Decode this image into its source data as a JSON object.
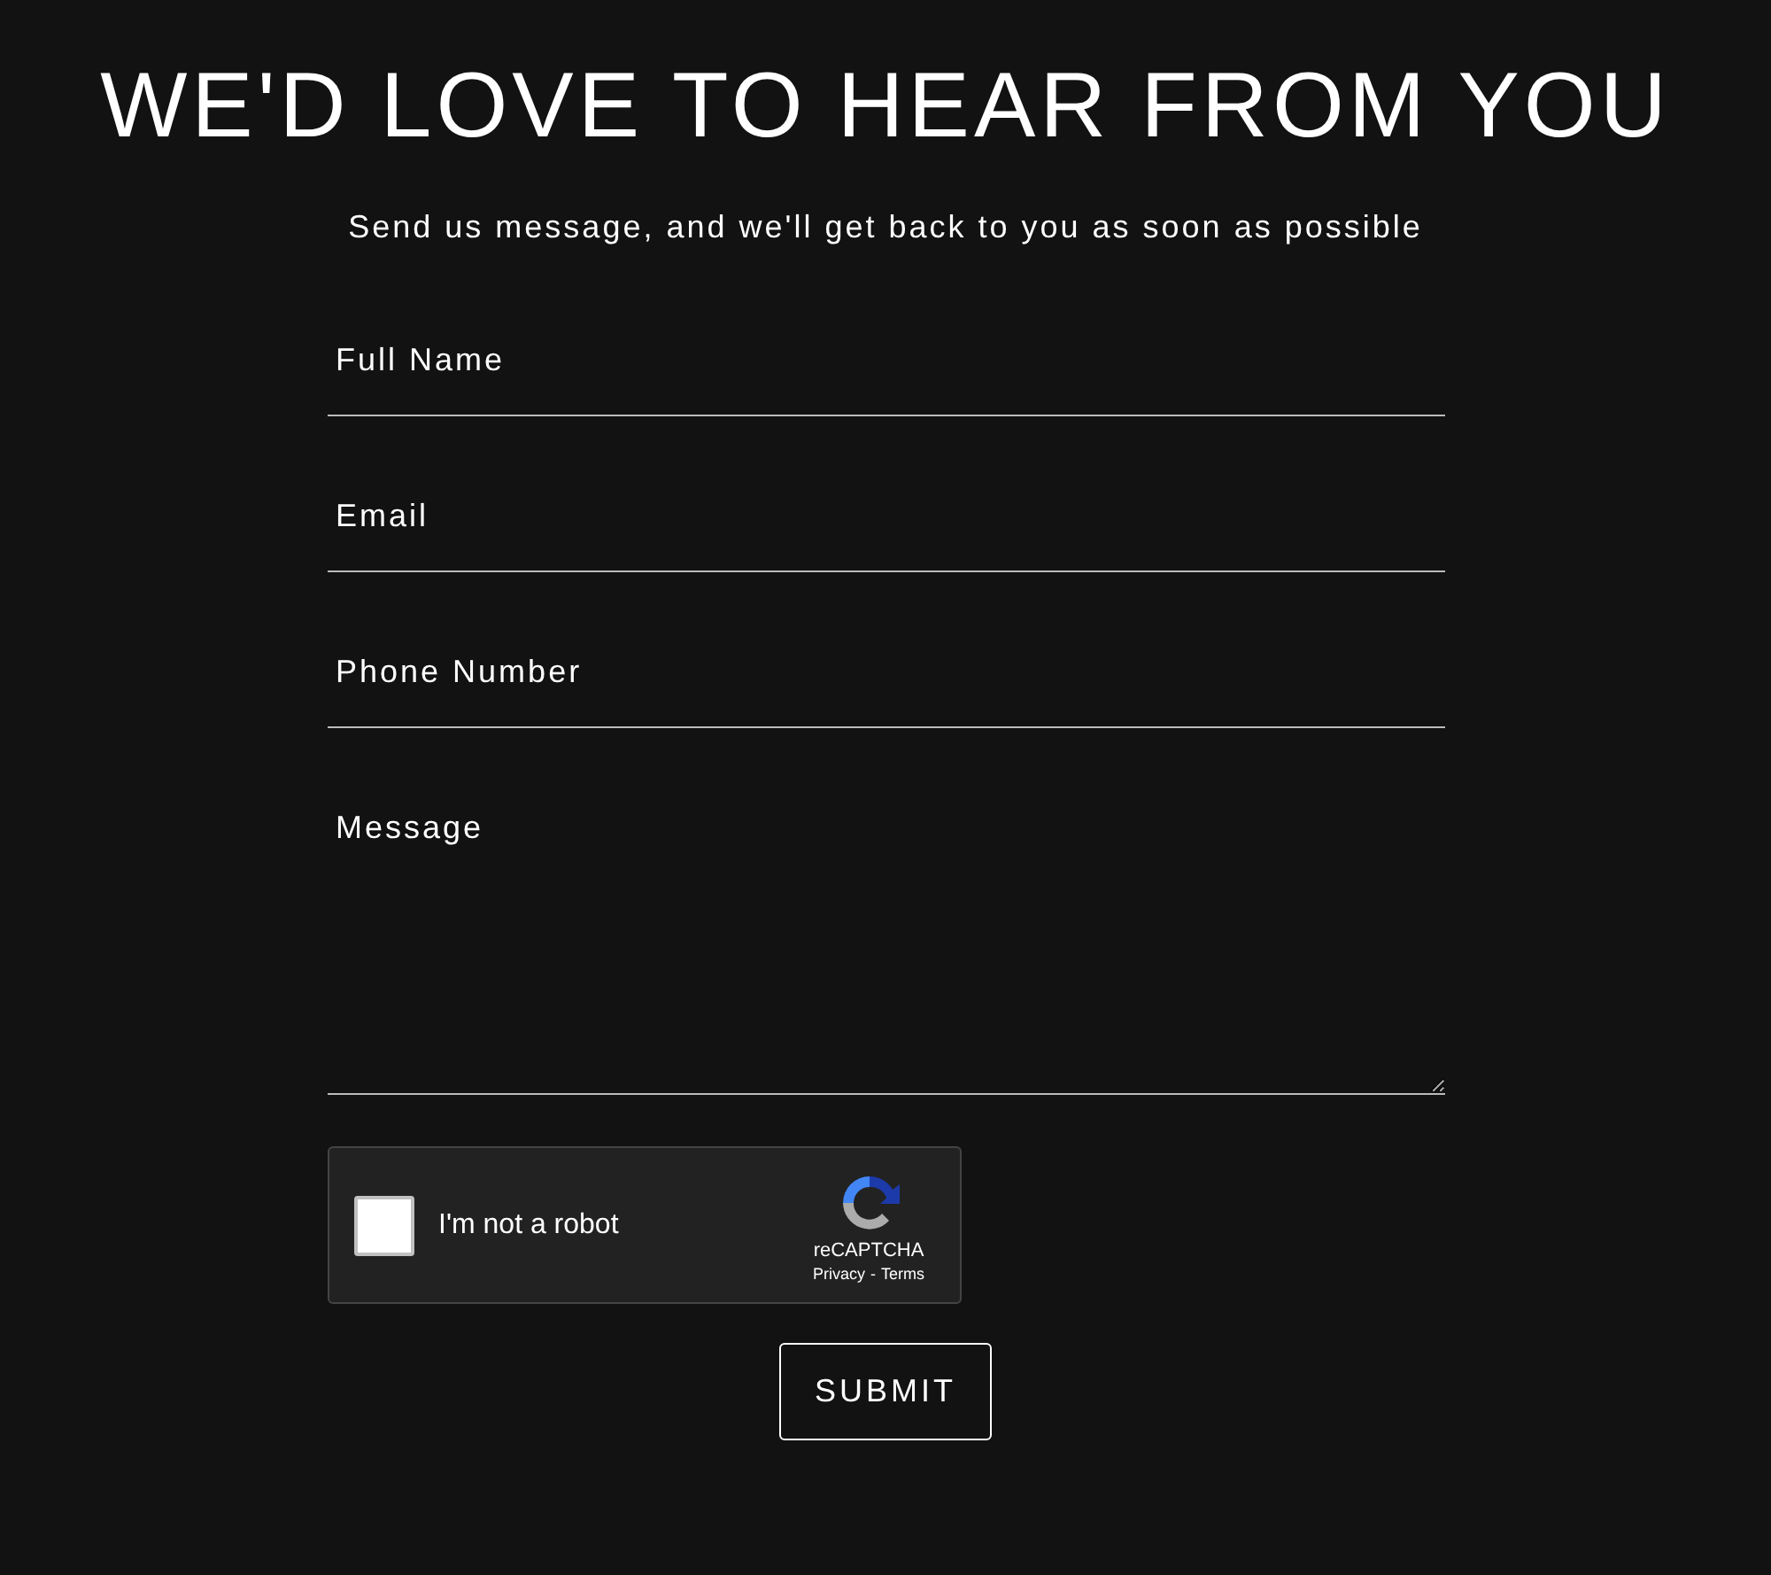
{
  "heading": "WE'D LOVE TO HEAR FROM YOU",
  "subheading": "Send us message, and we'll get back to you as soon as possible",
  "fields": [
    {
      "kind": "input",
      "placeholder": "Full Name"
    },
    {
      "kind": "input",
      "placeholder": "Email"
    },
    {
      "kind": "input",
      "placeholder": "Phone Number"
    },
    {
      "kind": "textarea",
      "placeholder": "Message"
    }
  ],
  "captcha": {
    "label": "I'm not a robot",
    "checked": false,
    "brand": "reCAPTCHA",
    "links": [
      "Privacy",
      "-",
      "Terms"
    ]
  },
  "submit": "SUBMIT"
}
